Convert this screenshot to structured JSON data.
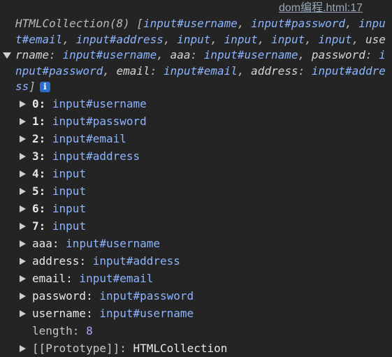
{
  "source_link": "dom编程.html:17",
  "summary": {
    "prefix": "HTMLCollection(8) [",
    "items": [
      {
        "ref": "input#username",
        "sep": ", "
      },
      {
        "ref": "input#password",
        "sep": ", "
      },
      {
        "ref": "input#email",
        "sep": ", "
      },
      {
        "ref": "input#address",
        "sep": ", "
      },
      {
        "ref": "input",
        "sep": ", "
      },
      {
        "ref": "input",
        "sep": ", "
      },
      {
        "ref": "input",
        "sep": ", "
      },
      {
        "ref": "input",
        "sep": ", "
      }
    ],
    "named": [
      {
        "key": "username",
        "colon": ": ",
        "ref": "input#username",
        "sep": ", "
      },
      {
        "key": "aaa",
        "colon": ": ",
        "ref": "input#username",
        "sep": ", "
      },
      {
        "key": "password",
        "colon": ": ",
        "ref": "input#password",
        "sep": ", "
      },
      {
        "key": "email",
        "colon": ": ",
        "ref": "input#email",
        "sep": ", "
      },
      {
        "key": "address",
        "colon": ": ",
        "ref": "input#address",
        "sep": ""
      }
    ],
    "suffix": "]",
    "info": "i"
  },
  "properties": [
    {
      "key": "0",
      "colon": ": ",
      "value": "input#username"
    },
    {
      "key": "1",
      "colon": ": ",
      "value": "input#password"
    },
    {
      "key": "2",
      "colon": ": ",
      "value": "input#email"
    },
    {
      "key": "3",
      "colon": ": ",
      "value": "input#address"
    },
    {
      "key": "4",
      "colon": ": ",
      "value": "input"
    },
    {
      "key": "5",
      "colon": ": ",
      "value": "input"
    },
    {
      "key": "6",
      "colon": ": ",
      "value": "input"
    },
    {
      "key": "7",
      "colon": ": ",
      "value": "input"
    },
    {
      "key": "aaa",
      "colon": ": ",
      "value": "input#username"
    },
    {
      "key": "address",
      "colon": ": ",
      "value": "input#address"
    },
    {
      "key": "email",
      "colon": ": ",
      "value": "input#email"
    },
    {
      "key": "password",
      "colon": ": ",
      "value": "input#password"
    },
    {
      "key": "username",
      "colon": ": ",
      "value": "input#username"
    }
  ],
  "length_prop": {
    "key": "length",
    "colon": ": ",
    "value": "8"
  },
  "prototype_prop": {
    "key": "[[Prototype]]",
    "colon": ": ",
    "value": "HTMLCollection"
  },
  "icons": {
    "collapse": "caret-down-icon",
    "expand": "caret-right-icon",
    "info": "info-icon"
  },
  "colors": {
    "background": "#242424",
    "ref": "#8cb4ff",
    "number": "#b9a0ff",
    "link": "#9aa7b8",
    "info_badge": "#2c6fcd"
  }
}
